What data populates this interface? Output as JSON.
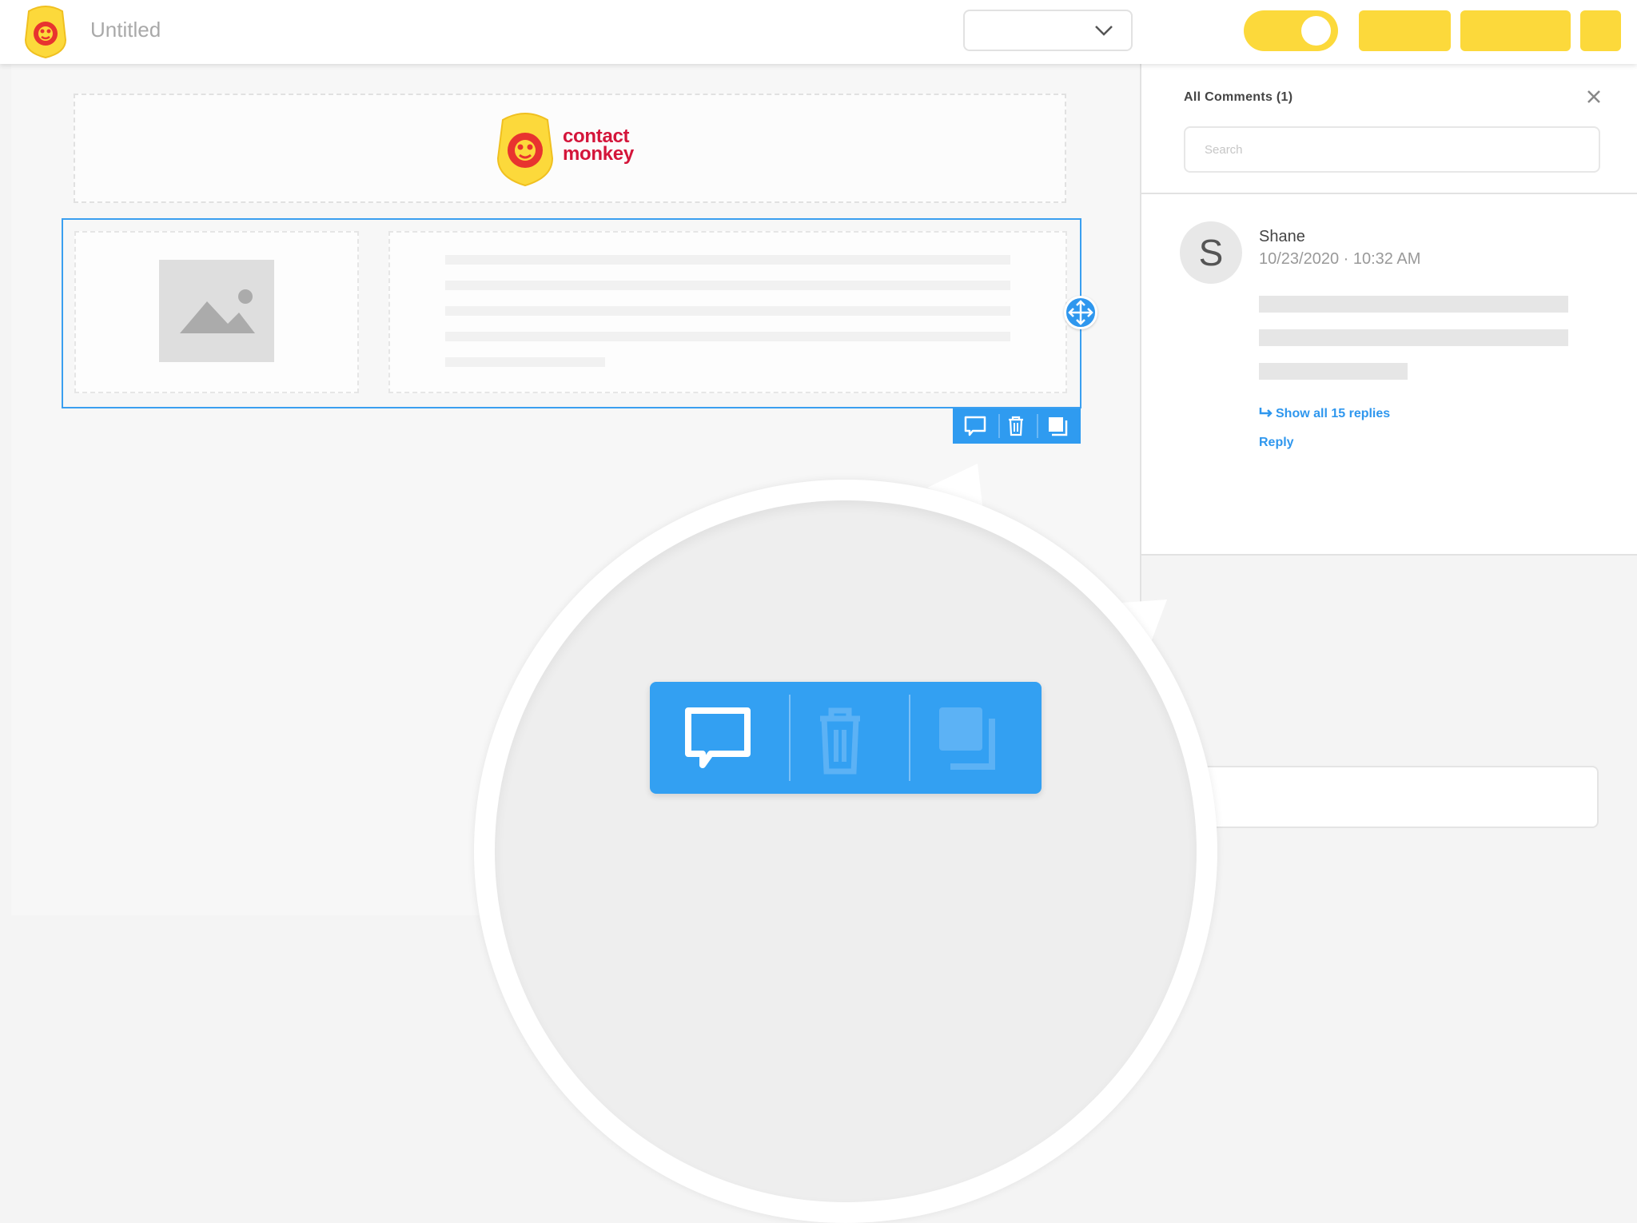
{
  "topbar": {
    "title": "Untitled",
    "select": {
      "value": ""
    }
  },
  "brand": {
    "line1": "contact",
    "line2": "monkey",
    "logo_color": "#fcd93b",
    "text_color": "#d4153a"
  },
  "colors": {
    "accent": "#2f97ee",
    "yellow": "#fcd93b",
    "selection": "#3a9ff0"
  },
  "icons": {
    "comment": "comment-icon",
    "delete": "trash-icon",
    "duplicate": "duplicate-icon",
    "move": "move-icon",
    "image": "image-placeholder-icon",
    "close": "close-icon",
    "reply": "reply-arrow-icon",
    "dropdown": "chevron-down-icon"
  },
  "comments_panel": {
    "title": "All Comments (1)",
    "search_placeholder": "Search",
    "comments": [
      {
        "initial": "S",
        "author": "Shane",
        "timestamp": "10/23/2020 · 10:32 AM",
        "show_replies": "Show all 15 replies",
        "reply": "Reply"
      }
    ]
  }
}
